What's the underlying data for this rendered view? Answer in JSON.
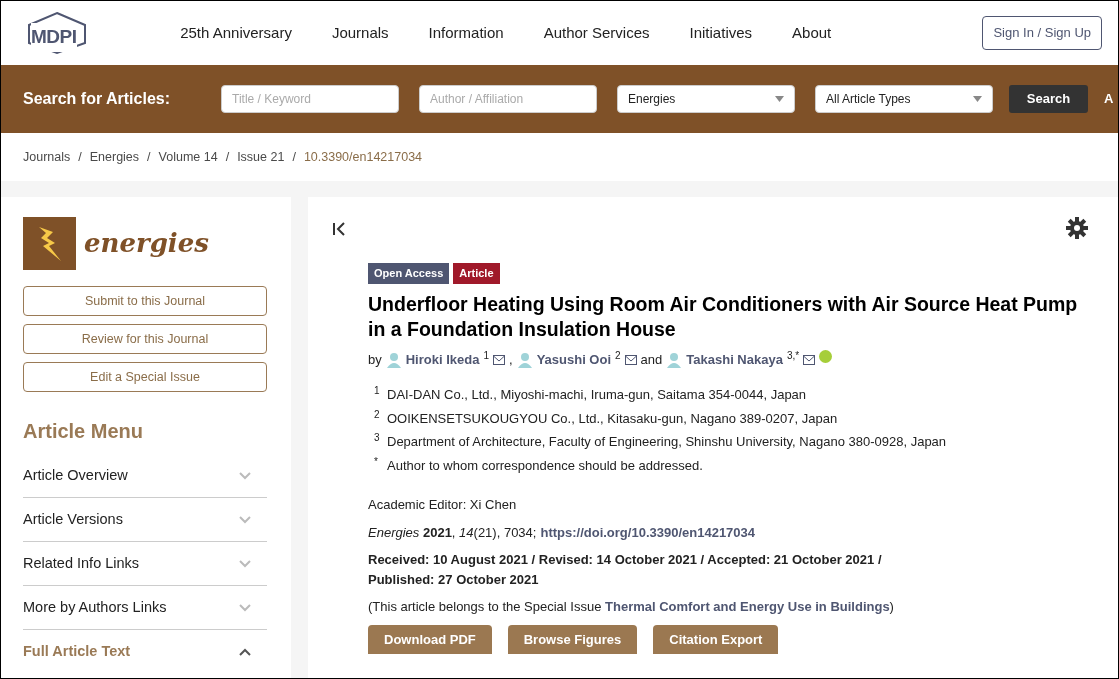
{
  "header": {
    "logo": "MDPI",
    "nav": [
      "25th Anniversary",
      "Journals",
      "Information",
      "Author Services",
      "Initiatives",
      "About"
    ],
    "sign_in": "Sign In / Sign Up"
  },
  "search_bar": {
    "label": "Search for Articles:",
    "fields": [
      {
        "kind": "input",
        "placeholder": "Title / Keyword"
      },
      {
        "kind": "input",
        "placeholder": "Author / Affiliation"
      },
      {
        "kind": "select",
        "value": "Energies"
      },
      {
        "kind": "select",
        "value": "All Article Types"
      }
    ],
    "button": "Search",
    "cut_link": "A"
  },
  "breadcrumb": [
    {
      "label": "Journals",
      "current": false,
      "sep": "/"
    },
    {
      "label": "Energies",
      "current": false,
      "sep": "/"
    },
    {
      "label": "Volume 14",
      "current": false,
      "sep": "/"
    },
    {
      "label": "Issue 21",
      "current": false,
      "sep": "/"
    },
    {
      "label": "10.3390/en14217034",
      "current": true
    }
  ],
  "sidebar": {
    "journal_name": "energies",
    "buttons": [
      "Submit to this Journal",
      "Review for this Journal",
      "Edit a Special Issue"
    ],
    "menu_title": "Article Menu",
    "items": [
      {
        "label": "Article Overview",
        "expanded": false
      },
      {
        "label": "Article Versions",
        "expanded": false
      },
      {
        "label": "Related Info Links",
        "expanded": false
      },
      {
        "label": "More by Authors Links",
        "expanded": false
      },
      {
        "label": "Full Article Text",
        "expanded": true
      }
    ]
  },
  "article": {
    "badges": [
      {
        "label": "Open Access",
        "color": "#4f5671"
      },
      {
        "label": "Article",
        "color": "#a0192a"
      }
    ],
    "title": "Underfloor Heating Using Room Air Conditioners with Air Source Heat Pump in a Foundation Insulation House",
    "byline": {
      "prefix": "by",
      "authors": [
        {
          "name": "Hiroki Ikeda",
          "sup": "1",
          "after": ",",
          "orcid": false
        },
        {
          "name": "Yasushi Ooi",
          "sup": "2",
          "after": "and",
          "orcid": false
        },
        {
          "name": "Takashi Nakaya",
          "sup": "3,*",
          "orcid": true
        }
      ]
    },
    "affiliations": [
      {
        "mark": "1",
        "text": "DAI-DAN Co., Ltd., Miyoshi-machi, Iruma-gun, Saitama 354-0044, Japan"
      },
      {
        "mark": "2",
        "text": "OOIKENSETSUKOUGYOU Co., Ltd., Kitasaku-gun, Nagano 389-0207, Japan"
      },
      {
        "mark": "3",
        "text": "Department of Architecture, Faculty of Engineering, Shinshu University, Nagano 380-0928, Japan"
      },
      {
        "mark": "*",
        "text": "Author to whom correspondence should be addressed."
      }
    ],
    "editor": "Academic Editor: Xi Chen",
    "citation": "*Energies* **2021**, *14*(21), 7034;",
    "doi": "https://doi.org/10.3390/en14217034",
    "dates": "Received: 10 August 2021 / Revised: 14 October 2021 / Accepted: 21 October 2021 / Published: 27 October 2021",
    "special_issue": {
      "prefix": "(This article belongs to the Special Issue",
      "link": "Thermal Comfort and Energy Use in Buildings",
      "suffix": ")"
    },
    "actions": [
      "Download PDF",
      "Browse Figures",
      "Citation Export"
    ]
  }
}
